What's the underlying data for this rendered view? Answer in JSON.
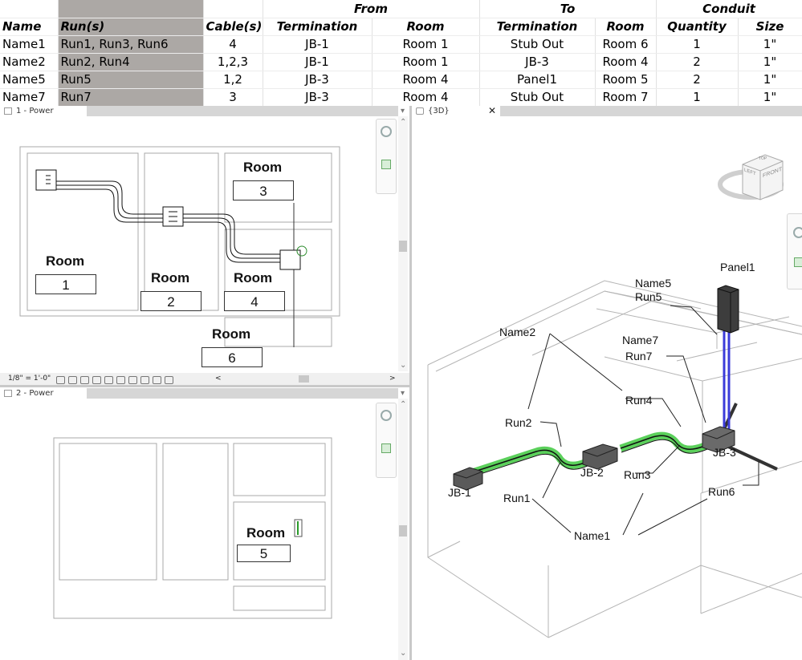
{
  "schedule": {
    "group_headers": {
      "from": "From",
      "to": "To",
      "conduit": "Conduit"
    },
    "columns": [
      "Name",
      "Run(s)",
      "Cable(s)",
      "Termination",
      "Room",
      "Termination",
      "Room",
      "Quantity",
      "Size"
    ],
    "rows": [
      [
        "Name1",
        "Run1, Run3, Run6",
        "4",
        "JB-1",
        "Room 1",
        "Stub Out",
        "Room 6",
        "1",
        "1\""
      ],
      [
        "Name2",
        "Run2, Run4",
        "1,2,3",
        "JB-1",
        "Room 1",
        "JB-3",
        "Room 4",
        "2",
        "1\""
      ],
      [
        "Name5",
        "Run5",
        "1,2",
        "JB-3",
        "Room 4",
        "Panel1",
        "Room 5",
        "2",
        "1\""
      ],
      [
        "Name7",
        "Run7",
        "3",
        "JB-3",
        "Room 4",
        "Stub Out",
        "Room 7",
        "1",
        "1\""
      ]
    ]
  },
  "view_power1": {
    "title": "1 - Power",
    "scale": "1/8\" = 1'-0\"",
    "rooms": [
      {
        "label": "Room",
        "number": "1"
      },
      {
        "label": "Room",
        "number": "2"
      },
      {
        "label": "Room",
        "number": "3"
      },
      {
        "label": "Room",
        "number": "4"
      },
      {
        "label": "Room",
        "number": "6"
      }
    ]
  },
  "view_power2": {
    "title": "2 - Power",
    "rooms": [
      {
        "label": "Room",
        "number": "5"
      }
    ]
  },
  "view_3d": {
    "title": "{3D}",
    "viewcube": {
      "front": "FRONT",
      "left": "LEFT",
      "top": "TOP"
    },
    "labels": {
      "panel1": "Panel1",
      "name5": "Name5",
      "run5": "Run5",
      "name2": "Name2",
      "name7": "Name7",
      "run7": "Run7",
      "run4": "Run4",
      "run2": "Run2",
      "jb3": "JB-3",
      "jb2": "JB-2",
      "jb1": "JB-1",
      "run3": "Run3",
      "run6": "Run6",
      "run1": "Run1",
      "name1": "Name1"
    }
  },
  "colors": {
    "header_highlight": "#aca8a5",
    "conduit_green": "#5bd05b",
    "panel_conduit_blue": "#3b3bd9"
  }
}
